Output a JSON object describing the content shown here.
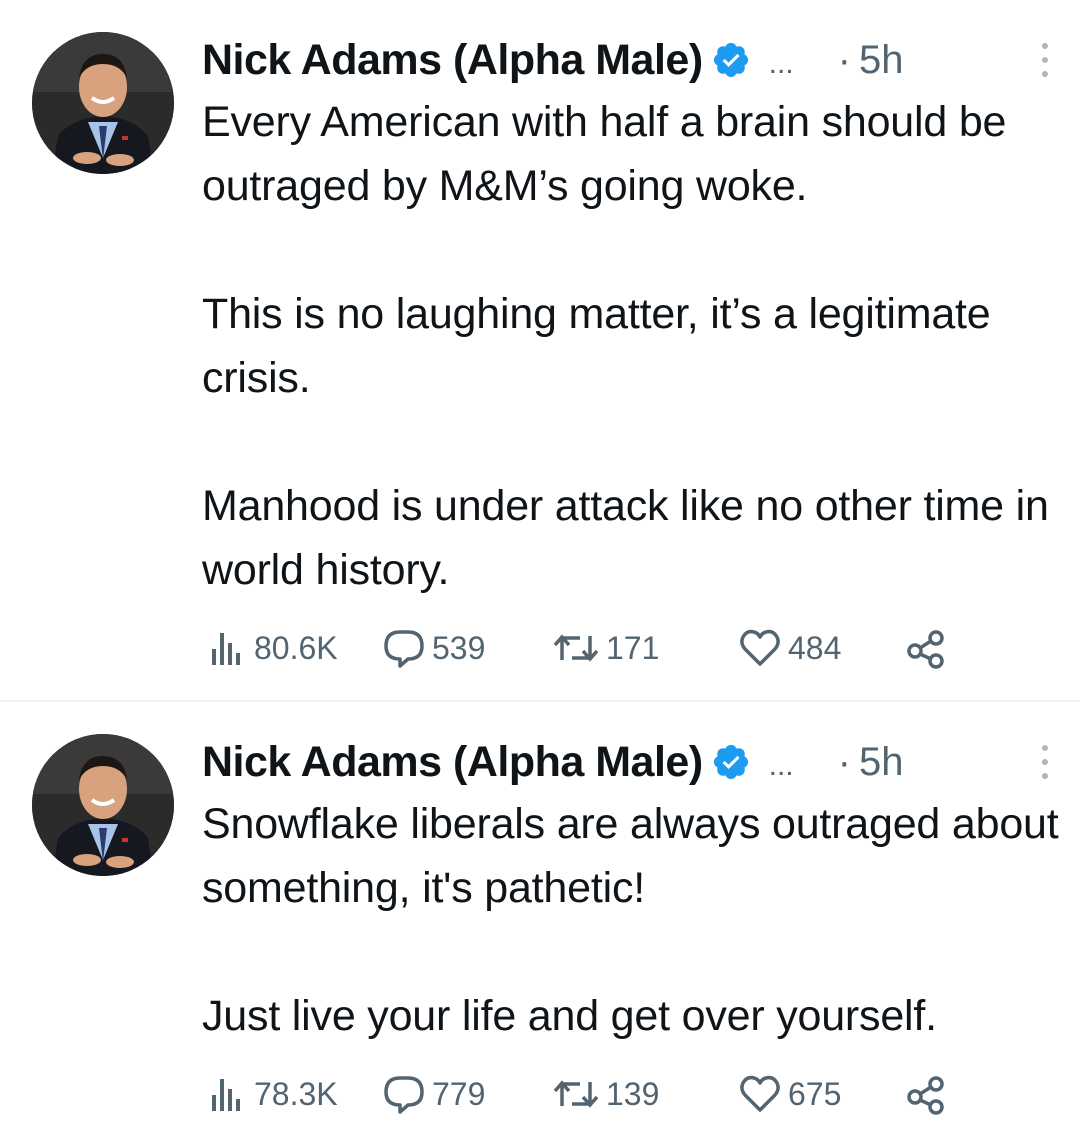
{
  "tweets": [
    {
      "author": "Nick Adams (Alpha Male)",
      "ellipsis": "...",
      "dot": "·",
      "time": "5h",
      "text": "Every American with half a brain should be outraged by M&M’s going woke.\n\nThis is no laughing matter, it’s a legitimate crisis.\n\nManhood is under attack like no other time in world history.",
      "views": "80.6K",
      "replies": "539",
      "retweets": "171",
      "likes": "484"
    },
    {
      "author": "Nick Adams (Alpha Male)",
      "ellipsis": "...",
      "dot": "·",
      "time": "5h",
      "text": "Snowflake liberals are always outraged about something, it's pathetic!\n\nJust live your life and get over yourself.",
      "views": "78.3K",
      "replies": "779",
      "retweets": "139",
      "likes": "675"
    }
  ],
  "icons": {
    "verified": "verified-badge-icon",
    "more": "more-options-icon",
    "views": "views-icon",
    "reply": "reply-icon",
    "retweet": "retweet-icon",
    "like": "like-icon",
    "share": "share-icon"
  },
  "colors": {
    "text": "#0f1419",
    "secondary": "#536471",
    "verified": "#1d9bf0",
    "divider": "#eff3f4"
  }
}
